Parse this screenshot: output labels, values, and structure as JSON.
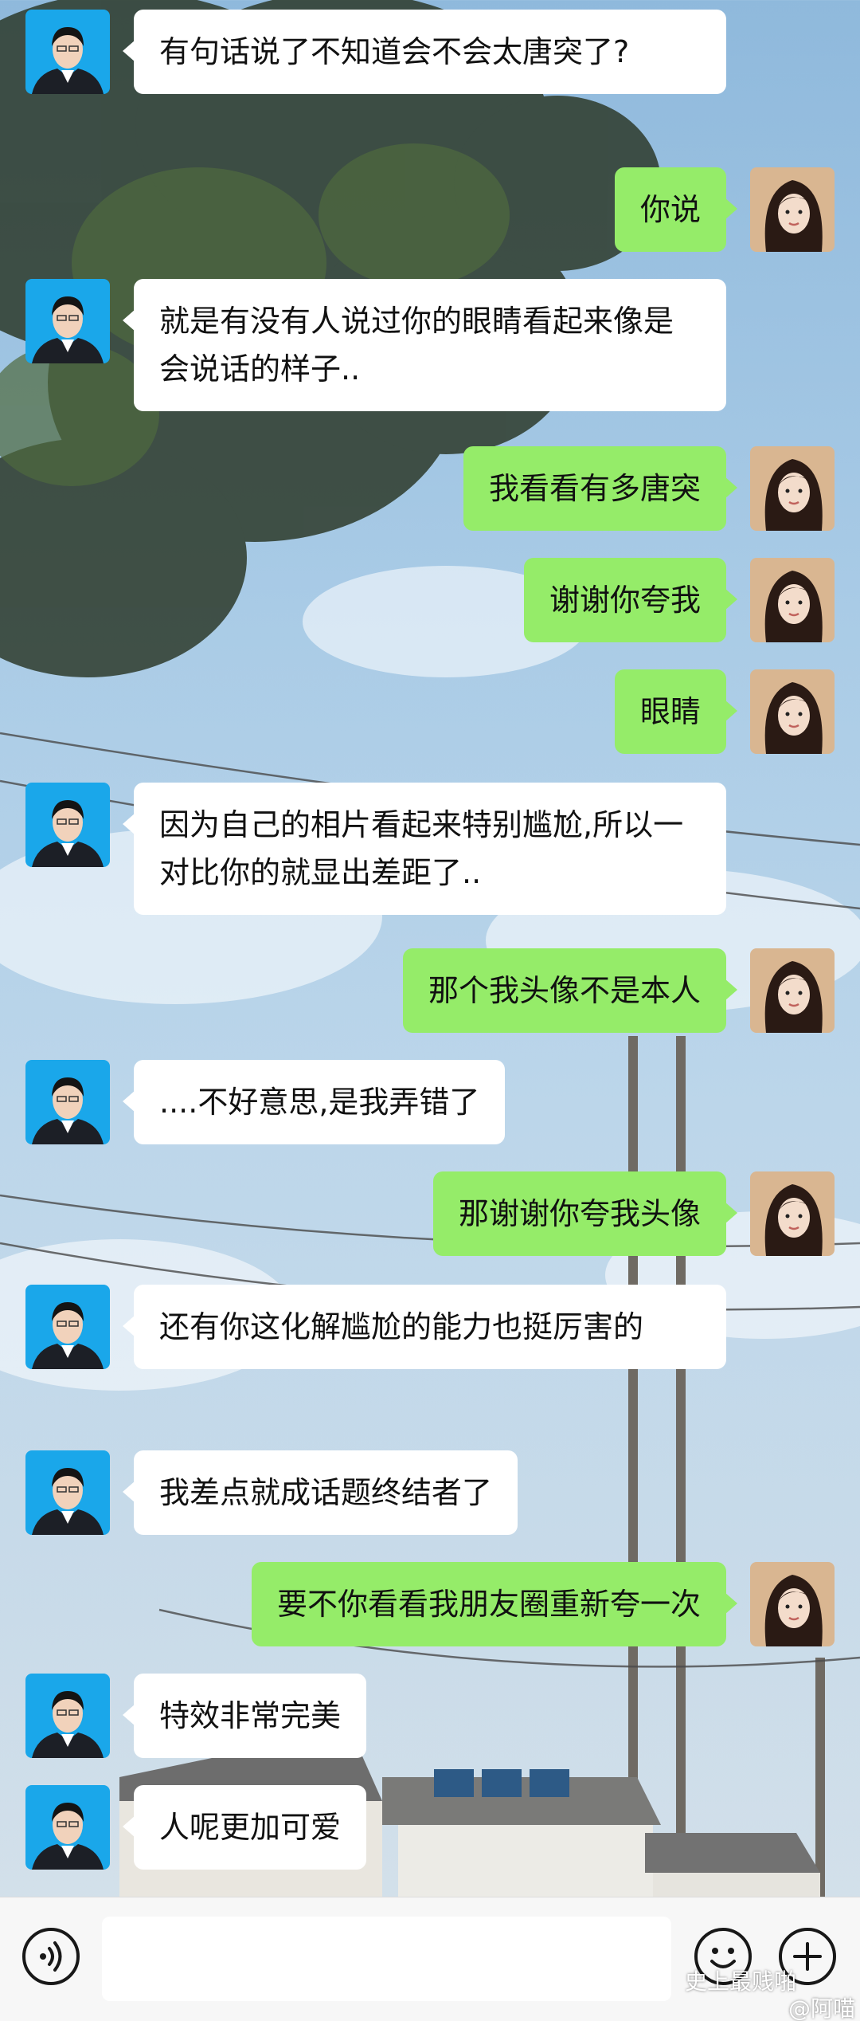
{
  "messages": [
    {
      "side": "left",
      "text": "有句话说了不知道会不会太唐突了?"
    },
    {
      "side": "right",
      "text": "你说"
    },
    {
      "side": "left",
      "text": "就是有没有人说过你的眼睛看起来像是会说话的样子.."
    },
    {
      "side": "right",
      "text": "我看看有多唐突"
    },
    {
      "side": "right",
      "text": "谢谢你夸我"
    },
    {
      "side": "right",
      "text": "眼睛"
    },
    {
      "side": "left",
      "text": "因为自己的相片看起来特别尴尬,所以一对比你的就显出差距了.."
    },
    {
      "side": "right",
      "text": "那个我头像不是本人"
    },
    {
      "side": "left",
      "text": "....不好意思,是我弄错了"
    },
    {
      "side": "right",
      "text": "那谢谢你夸我头像"
    },
    {
      "side": "left",
      "text": "还有你这化解尴尬的能力也挺厉害的"
    },
    {
      "side": "left",
      "text": "我差点就成话题终结者了"
    },
    {
      "side": "right",
      "text": "要不你看看我朋友圈重新夸一次"
    },
    {
      "side": "left",
      "text": "特效非常完美"
    },
    {
      "side": "left",
      "text": "人呢更加可爱"
    }
  ],
  "input_bar": {
    "voice_icon": "voice-icon",
    "emoji_icon": "emoji-icon",
    "plus_icon": "plus-icon"
  },
  "watermark": {
    "line1": "史上最贱啪",
    "line2": "@阿喵"
  },
  "colors": {
    "bubble_self": "#95ec69",
    "bubble_other": "#ffffff",
    "input_bar": "#f7f7f7"
  }
}
